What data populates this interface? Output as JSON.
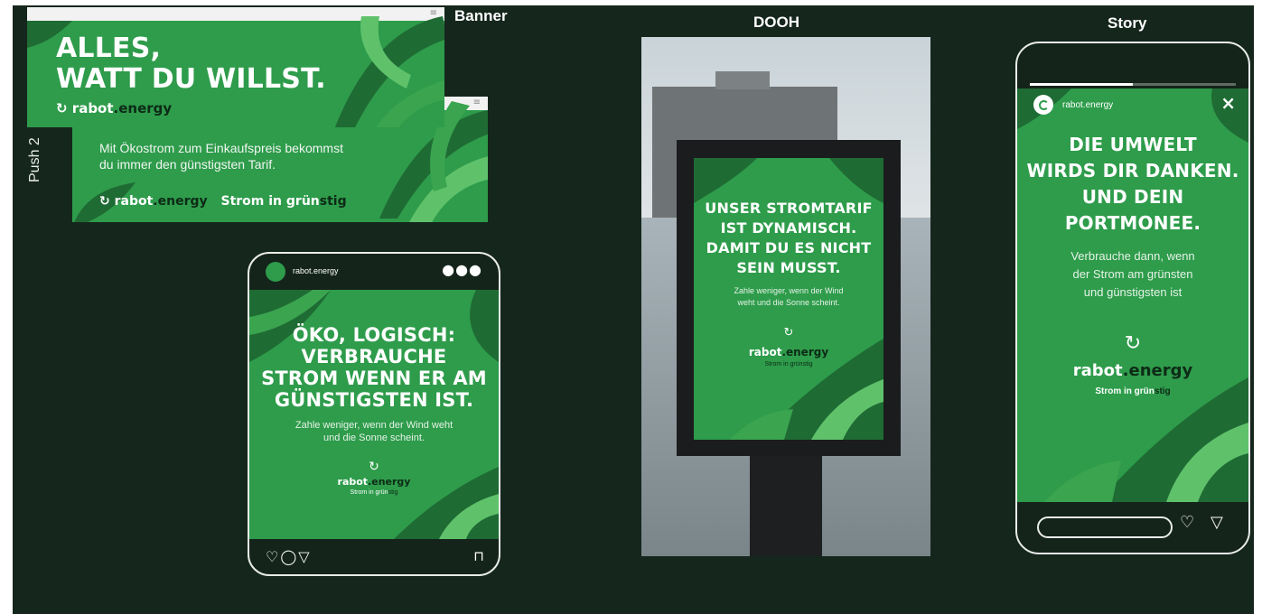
{
  "sections": {
    "banner": "Banner",
    "dooh": "DOOH",
    "story": "Story",
    "push": "Push 2"
  },
  "brand": {
    "name_a": "rabot",
    "name_b": ".energy",
    "tagline_a": "Strom in grün",
    "tagline_b": "stig",
    "tagline": "Strom in grünstig",
    "handle": "rabot.energy"
  },
  "banner": {
    "headline_1": "ALLES,",
    "headline_2": "WATT DU WILLST."
  },
  "push": {
    "text_1": "Mit Ökostrom zum Einkaufspreis bekommst",
    "text_2": "du immer den günstigsten Tarif."
  },
  "post": {
    "handle": "rabot.energy",
    "headline": [
      "ÖKO, LOGISCH:",
      "VERBRAUCHE",
      "STROM WENN ER AM",
      "GÜNSTIGSTEN IST."
    ],
    "body": [
      "Zahle weniger, wenn der Wind weht",
      "und die Sonne scheint."
    ]
  },
  "dooh": {
    "headline": [
      "UNSER STROMTARIF",
      "IST DYNAMISCH.",
      "DAMIT DU ES NICHT",
      "SEIN MUSST."
    ],
    "body": [
      "Zahle weniger, wenn der Wind",
      "weht und die Sonne scheint."
    ]
  },
  "story": {
    "handle": "rabot.energy",
    "headline": [
      "DIE UMWELT",
      "WIRDS DIR DANKEN.",
      "UND DEIN",
      "PORTMONEE."
    ],
    "body": [
      "Verbrauche dann, wenn",
      "der Strom am grünsten",
      "und günstigsten ist"
    ]
  },
  "colors": {
    "stage": "#15261d",
    "green": "#2e9c4b",
    "leaf_dark": "#1f6b34",
    "leaf_light": "#5fc26b"
  }
}
